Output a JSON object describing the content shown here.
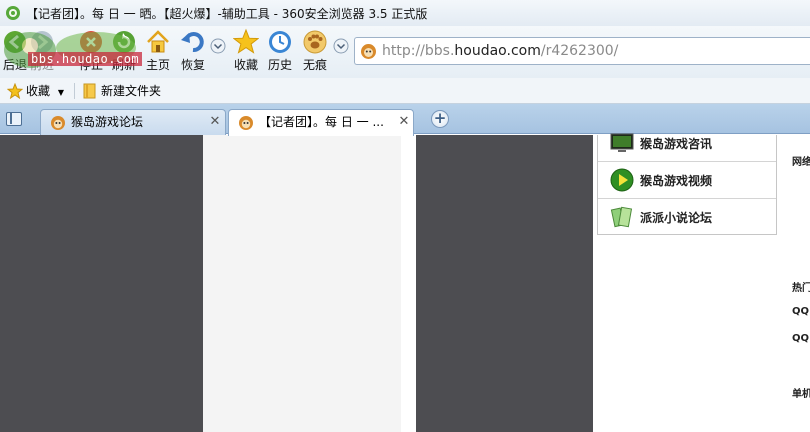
{
  "window": {
    "title": "【记者团】。每 日 一 晒。【超火爆】-辅助工具 - 360安全浏览器 3.5 正式版"
  },
  "toolbar": {
    "back_label": "后退",
    "forward_label": "前进",
    "stop_label": "停止",
    "refresh_label": "刷新",
    "home_label": "主页",
    "restore_label": "恢复",
    "favorites_label": "收藏",
    "history_label": "历史",
    "private_label": "无痕"
  },
  "address": {
    "url_prefix": "http://bbs.",
    "url_domain": "houdao.com",
    "url_path": "/r4262300/"
  },
  "watermark": {
    "text": "bbs.houdao.com"
  },
  "favbar": {
    "favorites_menu": "收藏",
    "new_folder": "新建文件夹"
  },
  "tabs": [
    {
      "label": "猴岛游戏论坛",
      "active": false
    },
    {
      "label": "【记者团】。每 日 一 ...",
      "active": true
    }
  ],
  "content": {
    "game_links": [
      {
        "label": "猴岛游戏咨讯",
        "icon": "monitor-icon"
      },
      {
        "label": "猴岛游戏视频",
        "icon": "play-icon"
      },
      {
        "label": "派派小说论坛",
        "icon": "books-icon"
      }
    ],
    "side_labels": [
      "网络",
      "热门",
      "QQ",
      "QQ",
      "单机"
    ]
  },
  "colors": {
    "dark_panel": "#4d4d51",
    "tab_bar": "#b9d2ea",
    "accent_blue": "#3d7bc8"
  }
}
